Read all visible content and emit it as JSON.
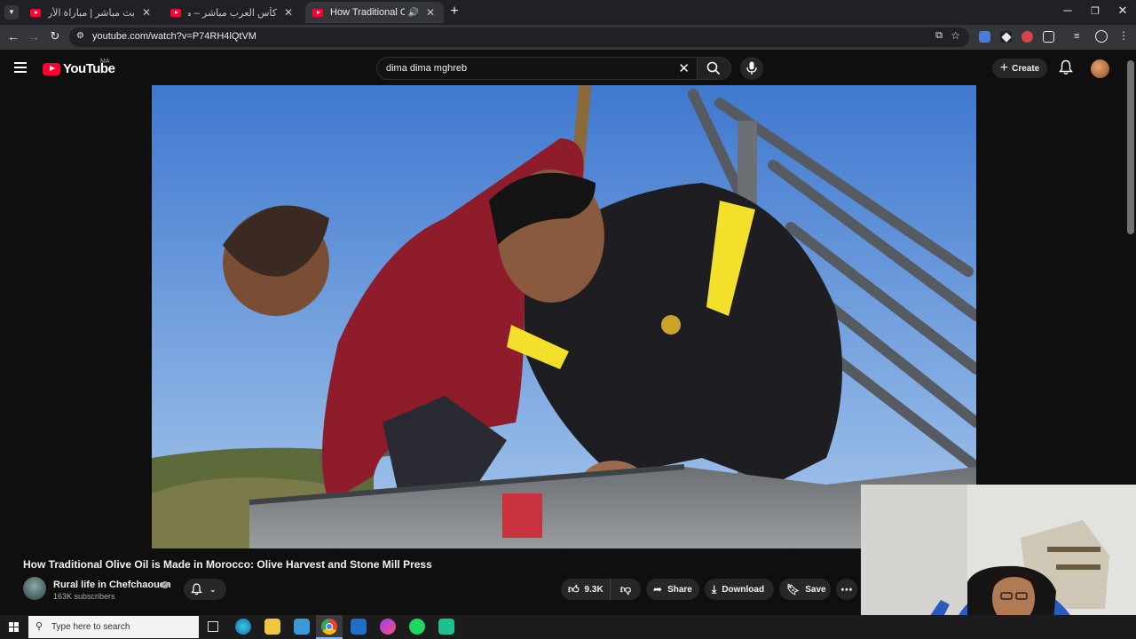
{
  "browser": {
    "tabs": [
      {
        "title": "بث مباشر | مباراة الأردن والمغرب"
      },
      {
        "title": "كأس العرب مباشر – مباراة : السعو"
      },
      {
        "title": "How Traditional Olive Oil is",
        "active": true
      }
    ],
    "url": "youtube.com/watch?v=P74RH4lQtVM",
    "new_tab_label": "+"
  },
  "youtube": {
    "logo_text": "YouTube",
    "country_code": "MA",
    "search": {
      "query": "dima dima mghreb"
    },
    "create_label": "Create"
  },
  "video": {
    "title": "How Traditional Olive Oil is Made in Morocco: Olive Harvest and Stone Mill Press",
    "channel": "Rural life in Chefchaouen",
    "subscribers": "163K subscribers",
    "likes": "9.3K",
    "share_label": "Share",
    "download_label": "Download",
    "save_label": "Save"
  },
  "taskbar": {
    "search_placeholder": "Type here to search"
  },
  "colors": {
    "brand": "#ff0033",
    "background": "#0f0f0f",
    "sky": "#5d8fd6"
  }
}
